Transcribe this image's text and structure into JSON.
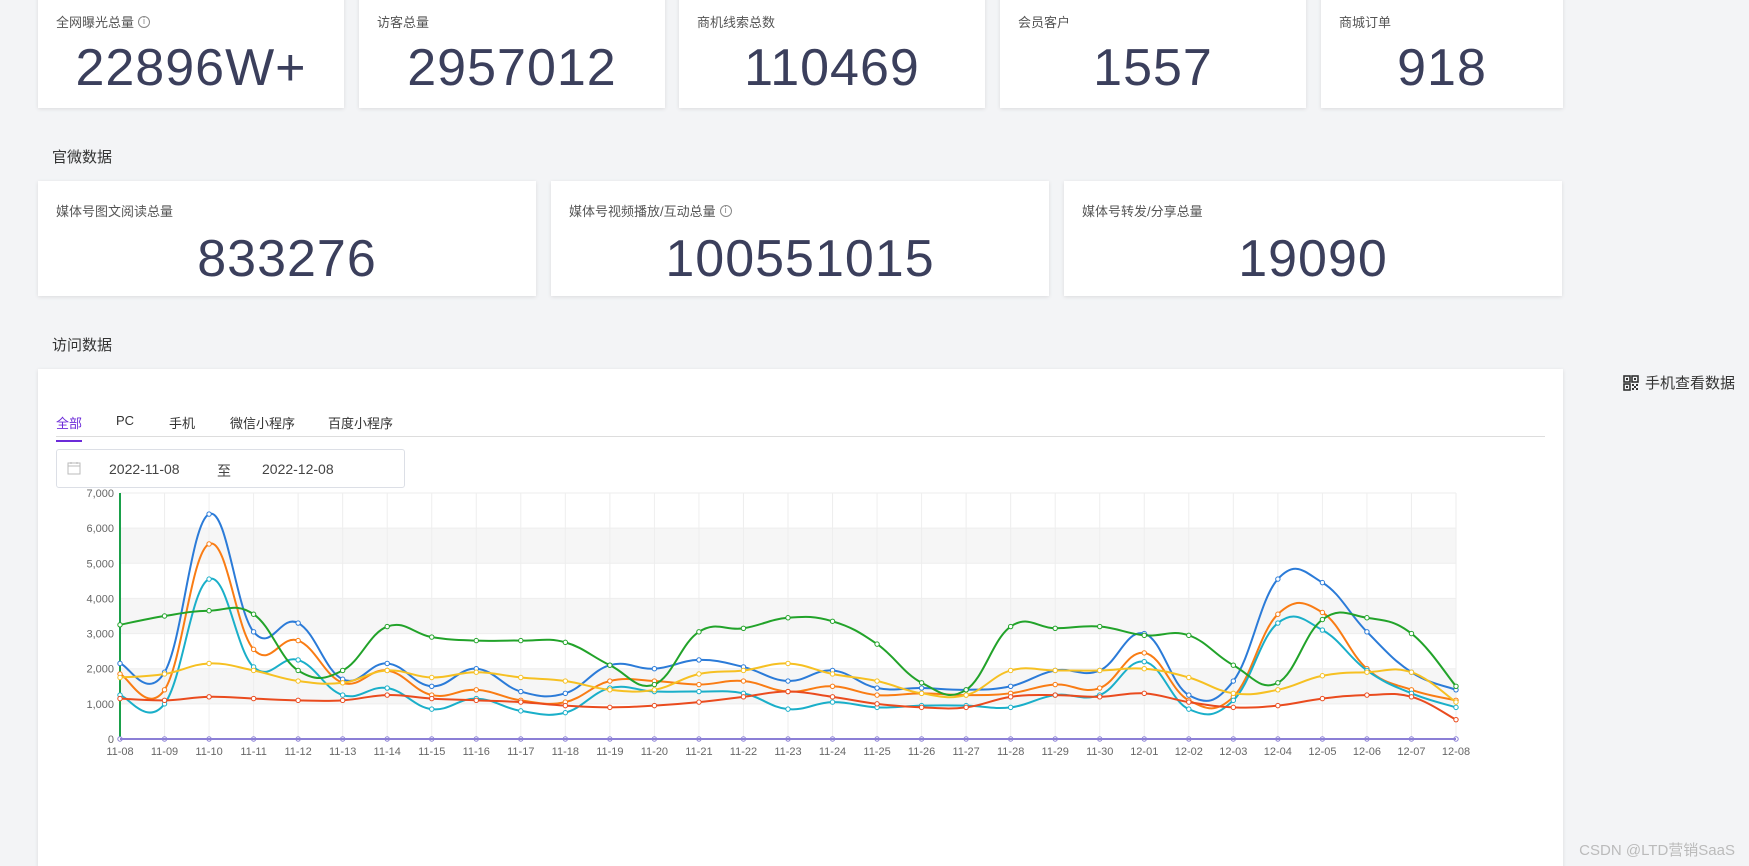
{
  "top_stats": [
    {
      "label": "全网曝光总量",
      "value": "22896W+",
      "info": true
    },
    {
      "label": "访客总量",
      "value": "2957012",
      "info": false
    },
    {
      "label": "商机线索总数",
      "value": "110469",
      "info": false
    },
    {
      "label": "会员客户",
      "value": "1557",
      "info": false
    },
    {
      "label": "商城订单",
      "value": "918",
      "info": false
    }
  ],
  "official_section": {
    "title": "官微数据",
    "stats": [
      {
        "label": "媒体号图文阅读总量",
        "value": "833276",
        "info": false
      },
      {
        "label": "媒体号视频播放/互动总量",
        "value": "100551015",
        "info": true
      },
      {
        "label": "媒体号转发/分享总量",
        "value": "19090",
        "info": false
      }
    ]
  },
  "visit_section": {
    "title": "访问数据",
    "mobile_link": "手机查看数据",
    "tabs": [
      "全部",
      "PC",
      "手机",
      "微信小程序",
      "百度小程序"
    ],
    "active_tab": 0,
    "date_from": "2022-11-08",
    "date_sep": "至",
    "date_to": "2022-12-08"
  },
  "colors": {
    "accent": "#6c2bd9",
    "blue": "#2b7bd8",
    "orange": "#f97c14",
    "cyan": "#1aafc9",
    "green": "#22a32a",
    "yellow": "#f6c022",
    "red": "#ea4b1e"
  },
  "chart_data": {
    "type": "line",
    "categories": [
      "11-08",
      "11-09",
      "11-10",
      "11-11",
      "11-12",
      "11-13",
      "11-14",
      "11-15",
      "11-16",
      "11-17",
      "11-18",
      "11-19",
      "11-20",
      "11-21",
      "11-22",
      "11-23",
      "11-24",
      "11-25",
      "11-26",
      "11-27",
      "11-28",
      "11-29",
      "11-30",
      "12-01",
      "12-02",
      "12-03",
      "12-04",
      "12-05",
      "12-06",
      "12-07",
      "12-08"
    ],
    "ylim": [
      0,
      7000
    ],
    "yticks": [
      "0",
      "1,000",
      "2,000",
      "3,000",
      "4,000",
      "5,000",
      "6,000",
      "7,000"
    ],
    "series": [
      {
        "color": "#2b7bd8",
        "values": [
          2150,
          1900,
          6400,
          3050,
          3300,
          1700,
          2150,
          1500,
          2000,
          1350,
          1300,
          2100,
          2000,
          2250,
          2050,
          1650,
          1950,
          1450,
          1450,
          1400,
          1500,
          1950,
          1950,
          3000,
          1250,
          1650,
          4550,
          4450,
          3050,
          1900,
          1400
        ]
      },
      {
        "color": "#f97c14",
        "values": [
          1850,
          1400,
          5550,
          2550,
          2800,
          1600,
          1950,
          1250,
          1400,
          1100,
          1050,
          1650,
          1650,
          1550,
          1650,
          1350,
          1500,
          1250,
          1300,
          1250,
          1300,
          1550,
          1450,
          2450,
          1100,
          1200,
          3550,
          3600,
          2000,
          1400,
          1100
        ]
      },
      {
        "color": "#1aafc9",
        "values": [
          1250,
          1000,
          4550,
          2050,
          2250,
          1250,
          1450,
          850,
          1150,
          800,
          750,
          1450,
          1350,
          1350,
          1300,
          850,
          1050,
          900,
          950,
          950,
          900,
          1250,
          1250,
          2200,
          850,
          1100,
          3300,
          3100,
          1950,
          1300,
          900
        ]
      },
      {
        "color": "#22a32a",
        "values": [
          3250,
          3500,
          3650,
          3550,
          1950,
          1950,
          3200,
          2900,
          2800,
          2800,
          2750,
          2100,
          1550,
          3050,
          3150,
          3450,
          3350,
          2700,
          1600,
          1400,
          3200,
          3150,
          3200,
          2950,
          2950,
          2100,
          1600,
          3400,
          3450,
          3000,
          1500
        ]
      },
      {
        "color": "#f6c022",
        "values": [
          1750,
          1850,
          2150,
          1950,
          1650,
          1600,
          1950,
          1750,
          1900,
          1750,
          1650,
          1400,
          1400,
          1850,
          1950,
          2150,
          1850,
          1650,
          1300,
          1250,
          1950,
          1950,
          1950,
          2000,
          1750,
          1300,
          1400,
          1800,
          1900,
          1900,
          1050
        ]
      },
      {
        "color": "#ea4b1e",
        "values": [
          1150,
          1100,
          1200,
          1150,
          1100,
          1100,
          1250,
          1150,
          1100,
          1050,
          950,
          900,
          950,
          1050,
          1200,
          1350,
          1200,
          1000,
          900,
          900,
          1200,
          1250,
          1200,
          1300,
          1050,
          900,
          950,
          1150,
          1250,
          1200,
          550
        ]
      },
      {
        "color": "#8b7fd6",
        "values": [
          0,
          0,
          0,
          0,
          0,
          0,
          0,
          0,
          0,
          0,
          0,
          0,
          0,
          0,
          0,
          0,
          0,
          0,
          0,
          0,
          0,
          0,
          0,
          0,
          0,
          0,
          0,
          0,
          0,
          0,
          0
        ]
      }
    ]
  },
  "watermark": "CSDN @LTD营销SaaS"
}
